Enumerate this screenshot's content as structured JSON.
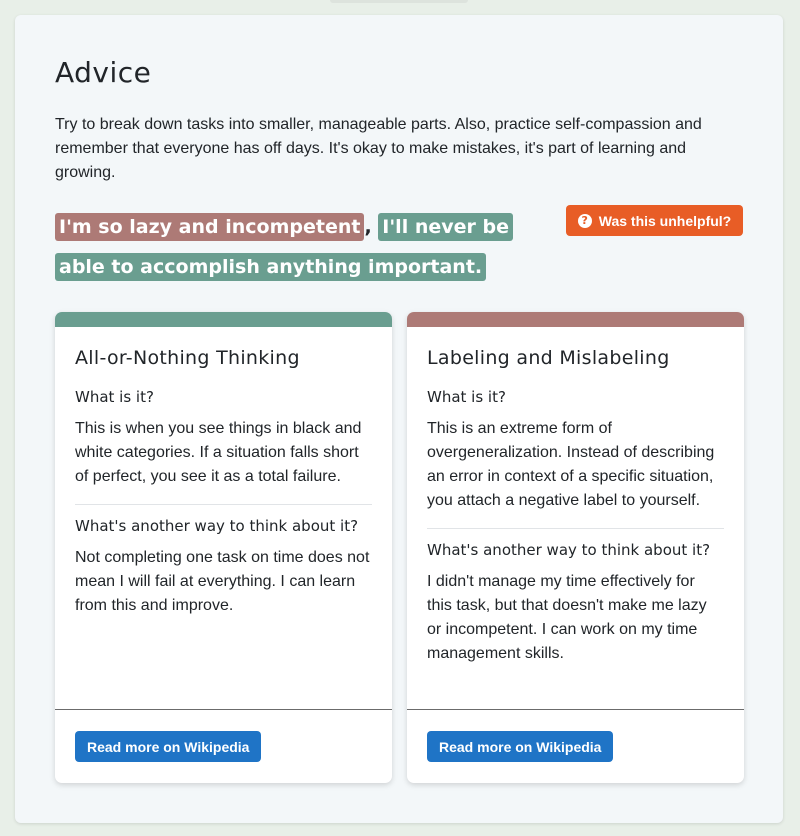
{
  "advice": {
    "title": "Advice",
    "text": "Try to break down tasks into smaller, manageable parts. Also, practice self-compassion and remember that everyone has off days. It's okay to make mistakes, it's part of learning and growing."
  },
  "thought": {
    "segments": [
      {
        "text": "I'm so lazy and incompetent",
        "color": "#ad7a76"
      },
      {
        "text": ", ",
        "color": null
      },
      {
        "text": "I'll never be able to accomplish anything important.",
        "color": "#6a9e90"
      }
    ]
  },
  "feedback": {
    "icon": "question-circle-icon",
    "label": "Was this unhelpful?",
    "color": "#e85d26"
  },
  "cards": [
    {
      "accent": "#6a9e90",
      "title": "All-or-Nothing Thinking",
      "what_heading": "What is it?",
      "what_text": "This is when you see things in black and white categories. If a situation falls short of perfect, you see it as a total failure.",
      "alt_heading": "What's another way to think about it?",
      "alt_text": "Not completing one task on time does not mean I will fail at everything. I can learn from this and improve.",
      "button": "Read more on Wikipedia"
    },
    {
      "accent": "#ad7a76",
      "title": "Labeling and Mislabeling",
      "what_heading": "What is it?",
      "what_text": "This is an extreme form of overgeneralization. Instead of describing an error in context of a specific situation, you attach a negative label to yourself.",
      "alt_heading": "What's another way to think about it?",
      "alt_text": "I didn't manage my time effectively for this task, but that doesn't make me lazy or incompetent. I can work on my time management skills.",
      "button": "Read more on Wikipedia"
    }
  ],
  "colors": {
    "page_background": "#e8efe8",
    "panel_background": "#f3f7f9",
    "button_blue": "#1f74c6"
  }
}
